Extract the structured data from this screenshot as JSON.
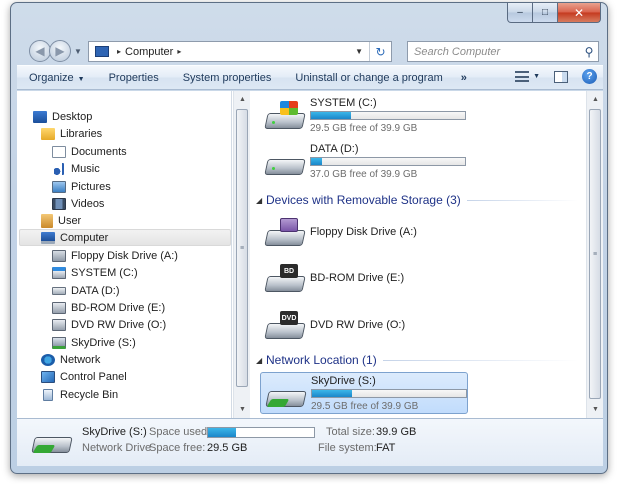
{
  "window": {
    "caption": {
      "minimize": "–",
      "maximize": "□",
      "close": "✕"
    }
  },
  "address": {
    "location": "Computer",
    "arrow": "▸",
    "search_placeholder": "Search Computer"
  },
  "toolbar": {
    "items": [
      "Organize",
      "Properties",
      "System properties",
      "Uninstall or change a program"
    ],
    "more": "»"
  },
  "nav": {
    "items": [
      {
        "label": "Desktop",
        "icon": "desktop-icon"
      },
      {
        "label": "Libraries",
        "icon": "libraries-icon"
      },
      {
        "label": "Documents",
        "icon": "documents-icon"
      },
      {
        "label": "Music",
        "icon": "music-icon"
      },
      {
        "label": "Pictures",
        "icon": "pictures-icon"
      },
      {
        "label": "Videos",
        "icon": "videos-icon"
      },
      {
        "label": "User",
        "icon": "user-icon"
      },
      {
        "label": "Computer",
        "icon": "computer-icon",
        "selected": true
      },
      {
        "label": "Floppy Disk Drive (A:)",
        "icon": "floppy-drive-icon"
      },
      {
        "label": "SYSTEM (C:)",
        "icon": "system-drive-icon"
      },
      {
        "label": "DATA (D:)",
        "icon": "data-drive-icon"
      },
      {
        "label": "BD-ROM Drive (E:)",
        "icon": "bd-rom-drive-icon"
      },
      {
        "label": "DVD RW Drive (O:)",
        "icon": "dvd-rw-drive-icon"
      },
      {
        "label": "SkyDrive (S:)",
        "icon": "skydrive-icon"
      },
      {
        "label": "Network",
        "icon": "network-icon"
      },
      {
        "label": "Control Panel",
        "icon": "control-panel-icon"
      },
      {
        "label": "Recycle Bin",
        "icon": "recycle-bin-icon"
      }
    ]
  },
  "content": {
    "hard_drives": [
      {
        "name": "SYSTEM (C:)",
        "free": "29.5 GB free of 39.9 GB",
        "used_fraction": 0.26
      },
      {
        "name": "DATA (D:)",
        "free": "37.0 GB free of 39.9 GB",
        "used_fraction": 0.07
      }
    ],
    "removable_group": "Devices with Removable Storage (3)",
    "removable": [
      {
        "name": "Floppy Disk Drive (A:)"
      },
      {
        "name": "BD-ROM Drive (E:)",
        "badge": "BD"
      },
      {
        "name": "DVD RW Drive (O:)",
        "badge": "DVD"
      }
    ],
    "network_group": "Network Location (1)",
    "network": [
      {
        "name": "SkyDrive (S:)",
        "free": "29.5 GB free of 39.9 GB",
        "used_fraction": 0.26
      }
    ]
  },
  "details": {
    "title": "SkyDrive (S:)",
    "subtitle": "Network Drive",
    "space_used_label": "Space used:",
    "space_used_fraction": 0.26,
    "space_free_label": "Space free:",
    "space_free_value": "29.5 GB",
    "total_size_label": "Total size:",
    "total_size_value": "39.9 GB",
    "file_system_label": "File system:",
    "file_system_value": "FAT"
  }
}
